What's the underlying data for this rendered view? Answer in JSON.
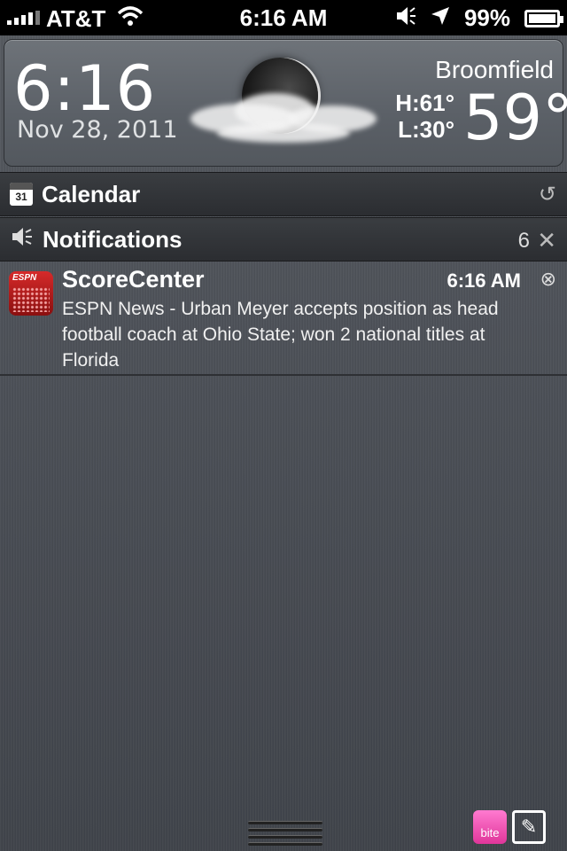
{
  "status_bar": {
    "carrier": "AT&T",
    "time": "6:16 AM",
    "battery_percent": "99%",
    "battery_level": 0.99
  },
  "weather": {
    "time": "6:16",
    "date": "Nov 28, 2011",
    "city": "Broomfield",
    "high": "H:61°",
    "low": "L:30°",
    "temperature": "59°",
    "condition_icon": "moon-cloud-icon"
  },
  "calendar": {
    "label": "Calendar",
    "icon_text": "31"
  },
  "notifications": {
    "label": "Notifications",
    "count": "6",
    "items": [
      {
        "app": "ScoreCenter",
        "time": "6:16 AM",
        "message": "ESPN News - Urban Meyer accepts position as head football coach at Ohio State; won 2 national titles at Florida"
      }
    ]
  },
  "bottom": {
    "bite_label": "bite"
  }
}
